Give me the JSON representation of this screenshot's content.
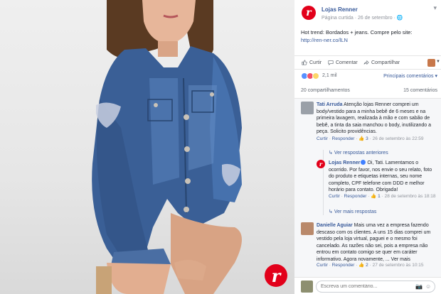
{
  "colors": {
    "brand": "#e2001a",
    "link": "#365899",
    "muted": "#90949c",
    "denim": "#3a5f96"
  },
  "photo": {
    "logo_letter": "r"
  },
  "post": {
    "page_name": "Lojas Renner",
    "page_type": "Página curtida",
    "date": "26 de setembro",
    "globe_icon": "globe-icon",
    "text": "Hot trend: Bordados + jeans. Compre pelo site:",
    "link": "http://ren-ner.co/lLN",
    "more": "▾"
  },
  "actions": {
    "like": "Curtir",
    "comment": "Comentar",
    "share": "Compartilhar"
  },
  "reactions": {
    "count": "2,1 mil",
    "top_comments": "Principais comentários ▾"
  },
  "stats": {
    "shares": "20 compartilhamentos",
    "comments": "15 comentários"
  },
  "comments": [
    {
      "author": "Tati Arruda",
      "text": "Atenção lojas Renner comprei um body/vestido para a minha bebê de 6 meses e na primeira lavagem, realizada à mão e com sabão de bebê, a tinta da saia manchou o body, inutilizando a peça. Solicito providências.",
      "like": "Curtir",
      "reply": "Responder",
      "likes": "3",
      "date": "26 de setembro às 22:59",
      "view_previous": "Ver respostas anteriores",
      "brand_reply": {
        "author": "Lojas Renner",
        "text": "Oi, Tati. Lamentamos o ocorrido. Por favor, nos envie o seu relato, foto do produto e etiquetas internas, seu nome completo, CPF telefone com DDD e melhor horário para contato. Obrigada!",
        "like": "Curtir",
        "reply": "Responder",
        "likes": "1",
        "date": "28 de setembro às 18:18"
      },
      "view_more": "Ver mais respostas"
    },
    {
      "author": "Danielle Aguiar",
      "text": "Mais uma vez a empresa fazendo descaso com os clientes. A uns 15 dias comprei um vestido pela loja virtual, paguei e o mesmo foi cancelado. As razões não sei, pois a empresa não entrou em contato comigo se quer em caráter informativo. Agora novamente, ... Ver mais",
      "like": "Curtir",
      "reply": "Responder",
      "likes": "2",
      "date": "27 de setembro às 10:15"
    }
  ],
  "compose": {
    "placeholder": "Escreva um comentário..."
  }
}
